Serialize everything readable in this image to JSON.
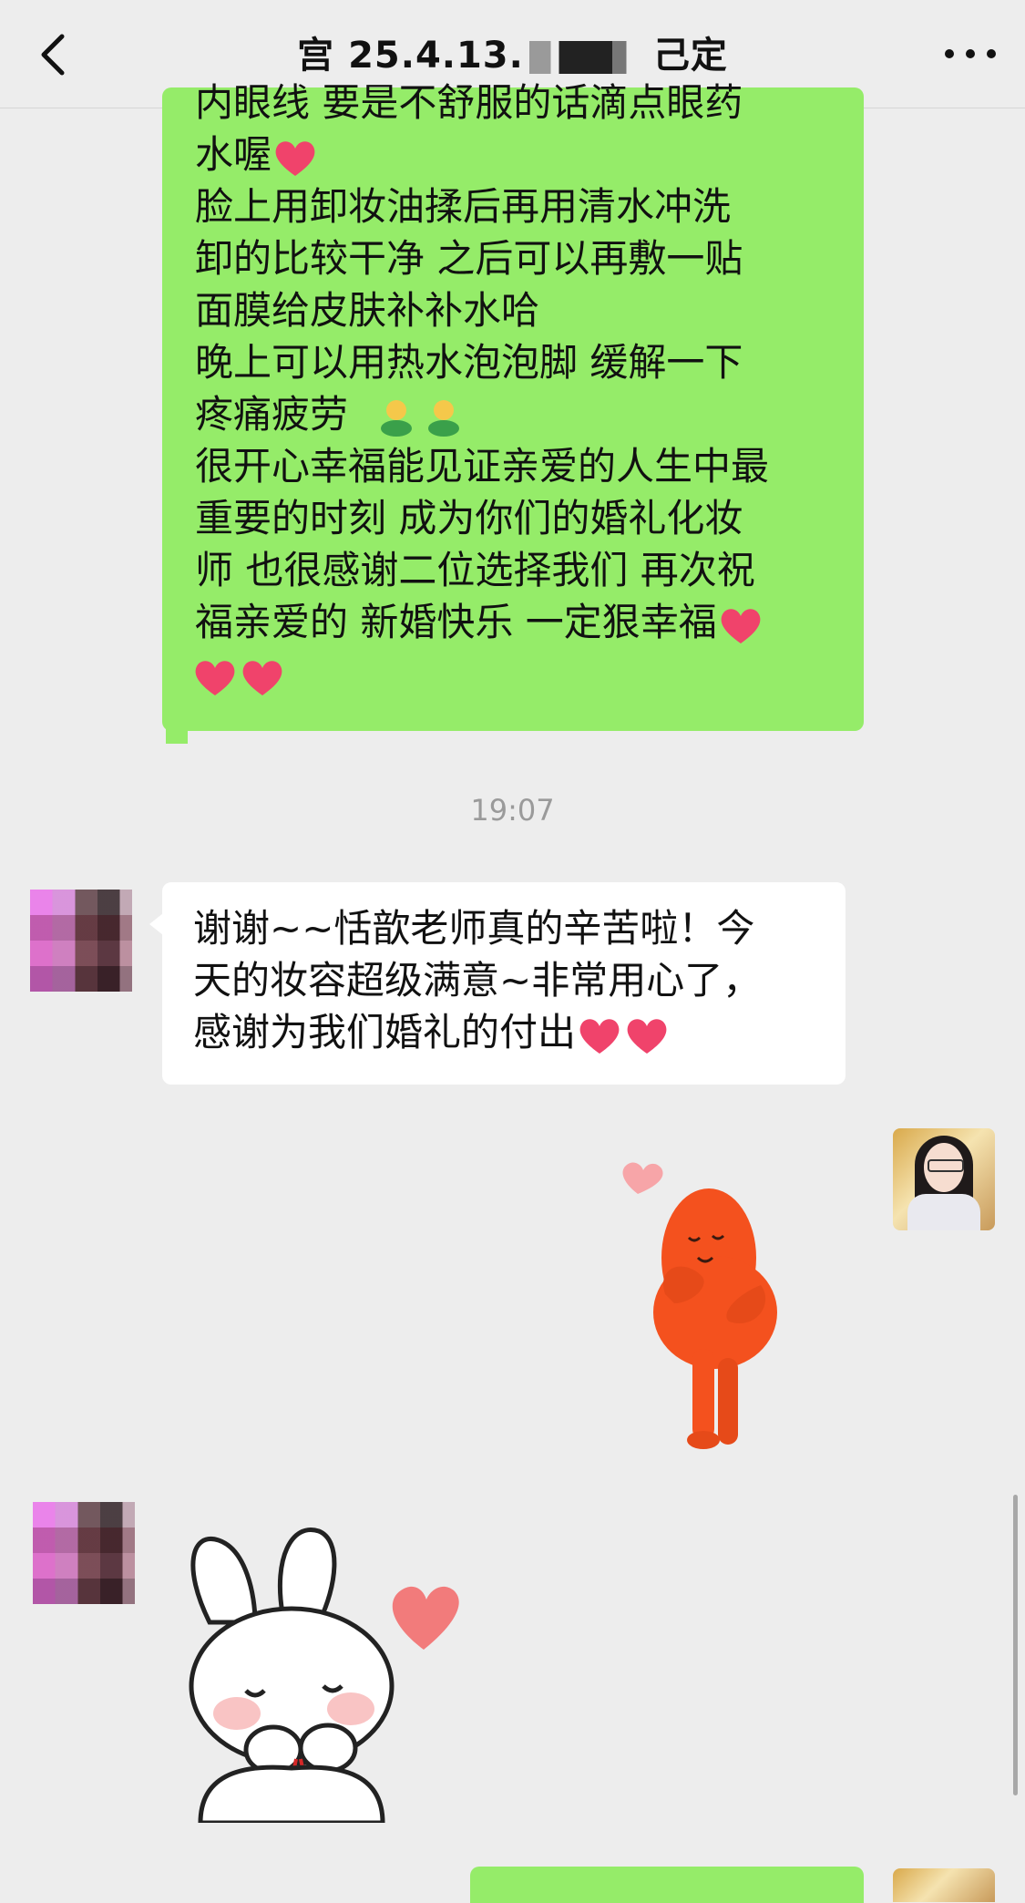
{
  "header": {
    "title_prefix": "宫 25.4.13.",
    "title_suffix": "己定",
    "back_icon": "chevron-left-icon",
    "more_icon": "more-dots-icon"
  },
  "messages": {
    "outgoing_text_lines": [
      "内眼线 要是不舒服的话滴点眼药",
      "水喔",
      "脸上用卸妆油揉后再用清水冲洗",
      "卸的比较干净 之后可以再敷一贴",
      "面膜给皮肤补补水哈",
      "晚上可以用热水泡泡脚 缓解一下",
      "疼痛疲劳",
      "很开心幸福能见证亲爱的人生中最",
      "重要的时刻 成为你们的婚礼化妆",
      "师 也很感谢二位选择我们 再次祝",
      "福亲爱的 新婚快乐 一定狠幸福"
    ],
    "timestamp": "19:07",
    "incoming_text_lines": [
      "谢谢~~恬歆老师真的辛苦啦！今",
      "天的妆容超级满意~非常用心了，",
      "感谢为我们婚礼的付出"
    ],
    "outgoing_sticker": "red-bean-hug-sticker",
    "incoming_sticker": "bunny-heart-sticker"
  },
  "colors": {
    "background": "#ededed",
    "outgoing_bubble": "#95ec69",
    "incoming_bubble": "#ffffff",
    "heart": "#f0436b",
    "timestamp": "#9a9a9a"
  }
}
